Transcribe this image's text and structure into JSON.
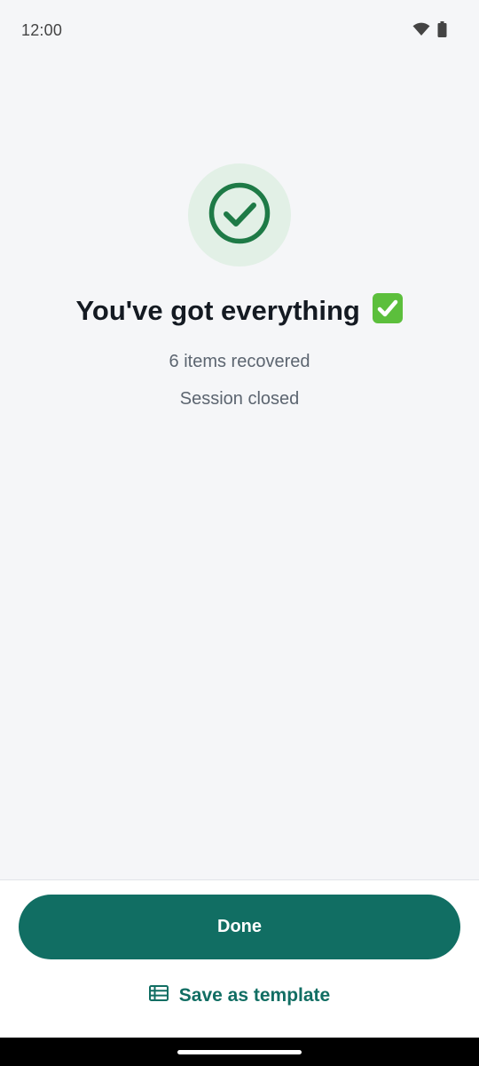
{
  "status_bar": {
    "time": "12:00",
    "icons": [
      "wifi-icon",
      "battery-icon"
    ]
  },
  "hero": {
    "icon": "check-circle-icon",
    "title": "You've got everything",
    "title_emoji": "✅",
    "lines": [
      "6 items recovered",
      "Session closed"
    ]
  },
  "actions": {
    "primary_label": "Done",
    "secondary_label": "Save as template",
    "secondary_icon": "list-icon"
  },
  "colors": {
    "accent": "#116e63",
    "success": "#1e7a46",
    "success_bg": "#e2f0e6",
    "background": "#f5f6f8"
  }
}
